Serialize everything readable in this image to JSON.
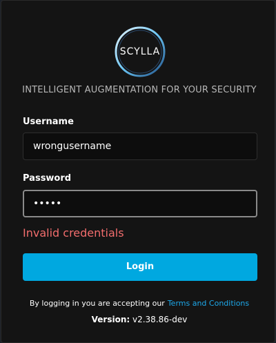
{
  "brand": {
    "logo_text": "SCYLLA",
    "tagline": "INTELLIGENT AUGMENTATION FOR YOUR SECURITY"
  },
  "form": {
    "username_label": "Username",
    "username_value": "wrongusername",
    "password_label": "Password",
    "password_masked": "•••••",
    "error_message": "Invalid credentials",
    "login_label": "Login"
  },
  "footer": {
    "terms_text": "By logging in you are accepting our",
    "terms_link": "Terms and Conditions",
    "version_label": "Version:",
    "version_value": "v2.38.86-dev"
  },
  "colors": {
    "accent": "#00a8e0",
    "error": "#f26d6d",
    "link": "#1da8ea",
    "card_bg": "#141414"
  },
  "icons": {
    "logo": "scylla-ring-logo"
  }
}
